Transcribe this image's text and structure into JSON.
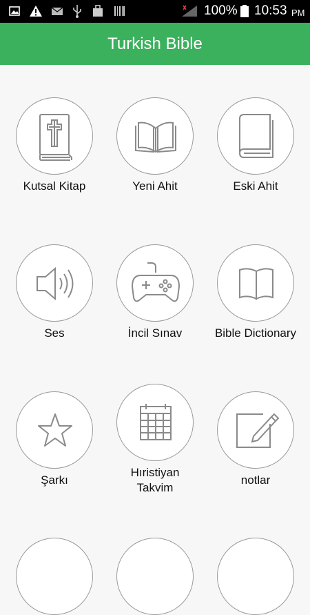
{
  "status_bar": {
    "battery": "100%",
    "time": "10:53",
    "ampm": "PM",
    "icons": [
      "image-icon",
      "warning-icon",
      "mail-icon",
      "usb-icon",
      "bag-icon",
      "barcode-icon",
      "signal-icon",
      "battery-icon"
    ]
  },
  "app_bar": {
    "title": "Turkish Bible"
  },
  "menu": [
    {
      "label": "Kutsal Kitap",
      "icon": "bible-icon"
    },
    {
      "label": "Yeni Ahit",
      "icon": "open-book-icon"
    },
    {
      "label": "Eski Ahit",
      "icon": "closed-book-icon"
    },
    {
      "label": "Ses",
      "icon": "speaker-icon"
    },
    {
      "label": "İncil Sınav",
      "icon": "gamepad-icon"
    },
    {
      "label": "Bible Dictionary",
      "icon": "dictionary-icon"
    },
    {
      "label": "Şarkı",
      "icon": "star-icon"
    },
    {
      "label_line1": "Hıristiyan",
      "label_line2": "Takvim",
      "icon": "calendar-icon"
    },
    {
      "label": "notlar",
      "icon": "notes-icon"
    }
  ],
  "colors": {
    "app_bar": "#3bb15d",
    "icon_stroke": "#8a8a8a",
    "background": "#f7f7f7"
  }
}
